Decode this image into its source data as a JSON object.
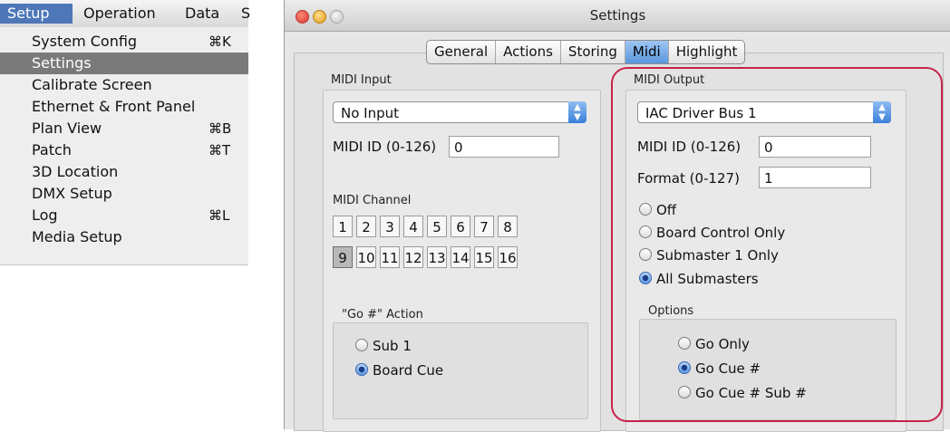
{
  "menu": {
    "bar": [
      "Setup",
      "Operation",
      "Data",
      "S"
    ],
    "items": [
      {
        "label": "System Config",
        "shortcut": "⌘K"
      },
      {
        "label": "Settings",
        "shortcut": ""
      },
      {
        "label": "Calibrate Screen",
        "shortcut": ""
      },
      {
        "label": "Ethernet & Front Panel",
        "shortcut": ""
      },
      {
        "label": "Plan View",
        "shortcut": "⌘B"
      },
      {
        "label": "Patch",
        "shortcut": "⌘T"
      },
      {
        "label": "3D Location",
        "shortcut": ""
      },
      {
        "label": "DMX Setup",
        "shortcut": ""
      },
      {
        "label": "Log",
        "shortcut": "⌘L"
      },
      {
        "label": "Media Setup",
        "shortcut": ""
      }
    ]
  },
  "window": {
    "title": "Settings",
    "tabs": [
      "General",
      "Actions",
      "Storing",
      "Midi",
      "Highlight"
    ],
    "active_tab": "Midi"
  },
  "midi_input": {
    "label": "MIDI Input",
    "source": "No Input",
    "midi_id_label": "MIDI ID (0-126)",
    "midi_id_value": "0",
    "channel_label": "MIDI Channel",
    "channels": [
      "1",
      "2",
      "3",
      "4",
      "5",
      "6",
      "7",
      "8",
      "9",
      "10",
      "11",
      "12",
      "13",
      "14",
      "15",
      "16"
    ],
    "selected_channel": "9",
    "go_action_label": "\"Go #\" Action",
    "go_action_options": [
      "Sub 1",
      "Board Cue"
    ],
    "go_action_selected": "Board Cue"
  },
  "midi_output": {
    "label": "MIDI Output",
    "destination": "IAC Driver Bus 1",
    "midi_id_label": "MIDI ID (0-126)",
    "midi_id_value": "0",
    "format_label": "Format (0-127)",
    "format_value": "1",
    "modes": [
      "Off",
      "Board Control Only",
      "Submaster 1 Only",
      "All Submasters"
    ],
    "mode_selected": "All Submasters",
    "options_label": "Options",
    "options": [
      "Go Only",
      "Go Cue #",
      "Go Cue # Sub #"
    ],
    "option_selected": "Go Cue #"
  },
  "colors": {
    "highlight": "#c6234a",
    "selection": "#4e77b8"
  }
}
